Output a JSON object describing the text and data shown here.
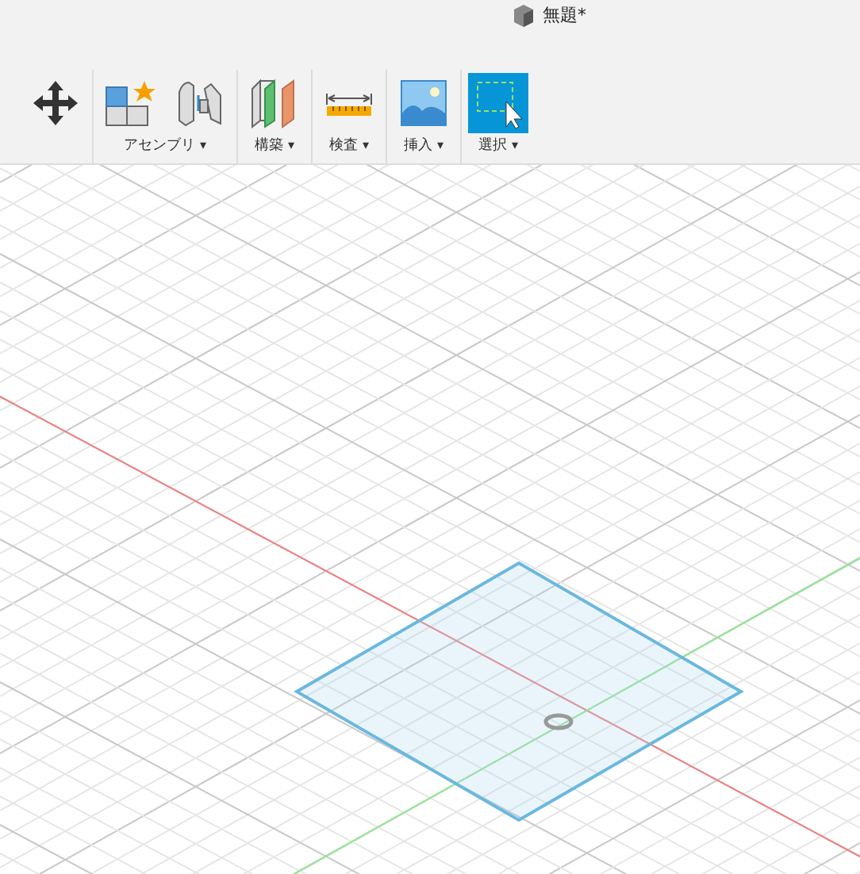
{
  "document": {
    "title": "無題*"
  },
  "toolbar": {
    "groups": [
      {
        "tools": [
          {
            "kind": "move",
            "selected": false
          }
        ]
      },
      {
        "label": "アセンブリ",
        "dropdown": "▾",
        "tools": [
          {
            "kind": "component",
            "selected": false
          },
          {
            "kind": "joint",
            "selected": false
          }
        ]
      },
      {
        "label": "構築",
        "dropdown": "▾",
        "tools": [
          {
            "kind": "plane",
            "selected": false
          }
        ]
      },
      {
        "label": "検査",
        "dropdown": "▾",
        "tools": [
          {
            "kind": "measure",
            "selected": false
          }
        ]
      },
      {
        "label": "挿入",
        "dropdown": "▾",
        "tools": [
          {
            "kind": "image",
            "selected": false
          }
        ]
      },
      {
        "label": "選択",
        "dropdown": "▾",
        "tools": [
          {
            "kind": "select",
            "selected": true
          }
        ]
      }
    ]
  }
}
